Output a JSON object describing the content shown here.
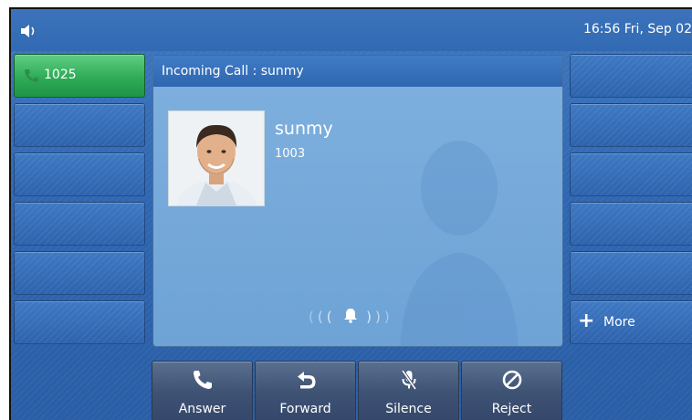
{
  "status_bar": {
    "clock": "16:56 Fri, Sep 02",
    "volume_icon": "speaker-icon"
  },
  "line_keys": [
    {
      "label": "1025",
      "icon": "phone-icon",
      "active": true
    },
    {
      "label": ""
    },
    {
      "label": ""
    },
    {
      "label": ""
    },
    {
      "label": ""
    },
    {
      "label": ""
    }
  ],
  "right_keys": [
    {
      "label": ""
    },
    {
      "label": ""
    },
    {
      "label": ""
    },
    {
      "label": ""
    },
    {
      "label": ""
    },
    {
      "label": "More",
      "icon": "plus-icon"
    }
  ],
  "call": {
    "header": "Incoming Call : sunmy",
    "name": "sunmy",
    "number": "1003",
    "ring_icon": "bell-icon"
  },
  "softkeys": [
    {
      "label": "Answer",
      "icon": "phone-icon"
    },
    {
      "label": "Forward",
      "icon": "forward-arrow-icon"
    },
    {
      "label": "Silence",
      "icon": "mute-mic-icon"
    },
    {
      "label": "Reject",
      "icon": "reject-circle-icon"
    }
  ],
  "colors": {
    "active_line": "#2fab57",
    "screen_bg": "#2f67b2",
    "softkey_bg": "#3e5274"
  }
}
